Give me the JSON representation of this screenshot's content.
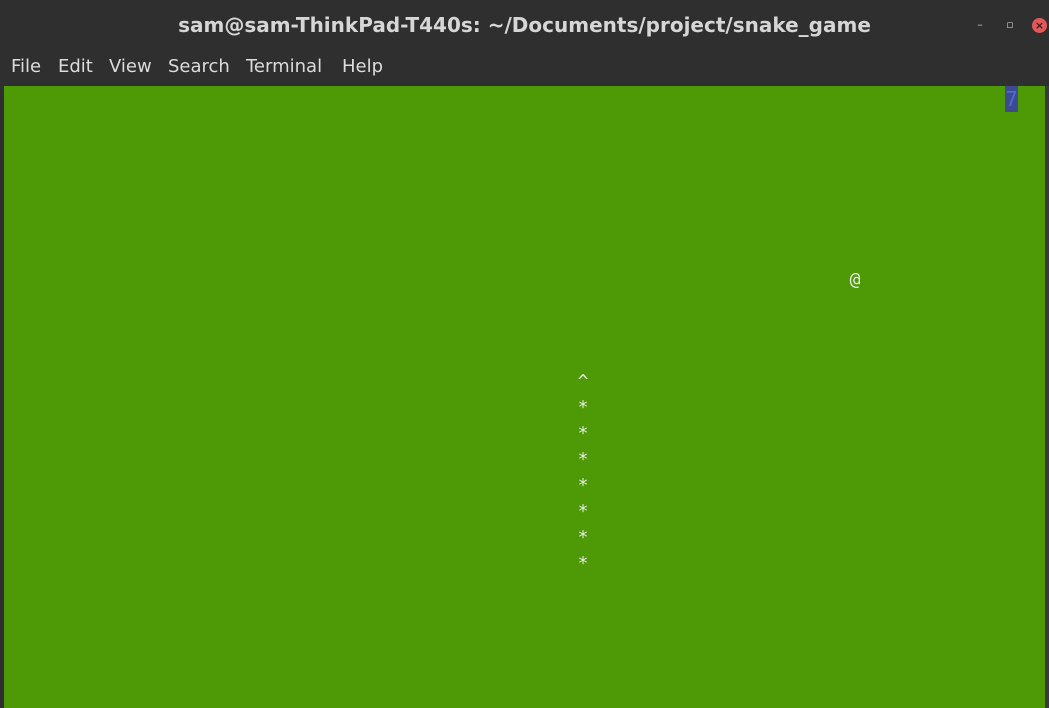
{
  "window": {
    "title": "sam@sam-ThinkPad-T440s: ~/Documents/project/snake_game",
    "controls": {
      "minimize": "–",
      "maximize": "▫",
      "close": "×"
    }
  },
  "menu": {
    "file": "File",
    "edit": "Edit",
    "view": "View",
    "search": "Search",
    "terminal": "Terminal",
    "help": "Help"
  },
  "game": {
    "score": "7",
    "food": "@",
    "snake_head": "^",
    "snake_body": [
      "*",
      "*",
      "*",
      "*",
      "*",
      "*",
      "*"
    ]
  },
  "colors": {
    "terminal_background": "#4e9a06",
    "titlebar": "#2f2f2f",
    "text": "#e8e8e8",
    "score_highlight": "#3d4a8f",
    "close_button": "#e2585a"
  }
}
